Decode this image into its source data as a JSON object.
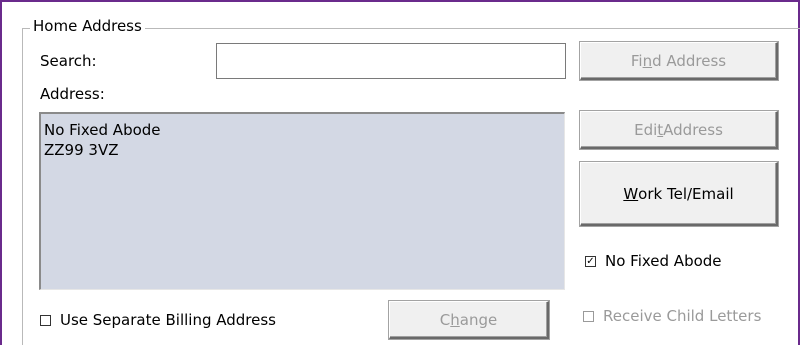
{
  "group": {
    "title": "Home Address"
  },
  "search": {
    "label": "Search:",
    "value": "",
    "find_button": {
      "pre": "Fi",
      "accel": "n",
      "post": "d Address"
    }
  },
  "address": {
    "label": "Address:",
    "lines": [
      "No Fixed Abode",
      "ZZ99 3VZ"
    ],
    "edit_button": {
      "pre": "Edi",
      "accel": "t",
      "post": " Address"
    },
    "work_button": {
      "pre": "",
      "accel": "W",
      "post": "ork Tel/Email"
    }
  },
  "no_fixed_abode": {
    "label": "No Fixed Abode",
    "checked": true
  },
  "billing": {
    "label": "Use Separate Billing Address",
    "checked": false,
    "change_button": {
      "pre": "C",
      "accel": "h",
      "post": "ange"
    }
  },
  "child_letters": {
    "label": "Receive Child Letters",
    "checked": false
  }
}
